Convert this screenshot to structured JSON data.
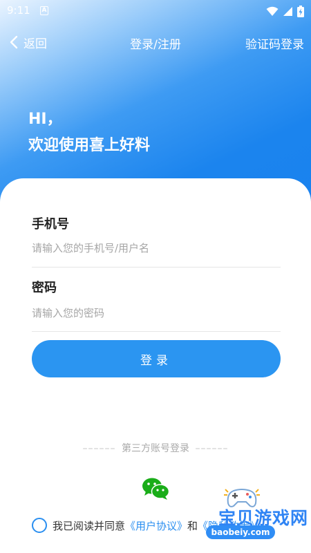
{
  "status_bar": {
    "time": "9:11",
    "notification_icon": "a-badge-icon",
    "icons": [
      "wifi-icon",
      "signal-icon",
      "battery-icon"
    ]
  },
  "nav": {
    "back_label": "返回",
    "title": "登录/注册",
    "right_action": "验证码登录"
  },
  "greeting": {
    "line1": "HI，",
    "line2": "欢迎使用喜上好料"
  },
  "form": {
    "phone": {
      "label": "手机号",
      "placeholder": "请输入您的手机号/用户名",
      "value": ""
    },
    "password": {
      "label": "密码",
      "placeholder": "请输入您的密码",
      "value": ""
    },
    "login_button": "登录"
  },
  "third_party": {
    "dashes": "––––––",
    "label": "第三方账号登录",
    "icon": "wechat-icon"
  },
  "agreement": {
    "checked": false,
    "prefix": "我已阅读并同意",
    "user_agreement": "《用户协议》",
    "and": "和",
    "privacy_policy": "《隐私政策》"
  },
  "watermark": {
    "text": "宝贝游戏网",
    "url": "baobeiy.com"
  },
  "colors": {
    "accent": "#2b95f1",
    "hero_gradient": [
      "#eaf4ff",
      "#3e9bf3",
      "#1a82ef"
    ],
    "wechat_green": "#1aad19"
  }
}
